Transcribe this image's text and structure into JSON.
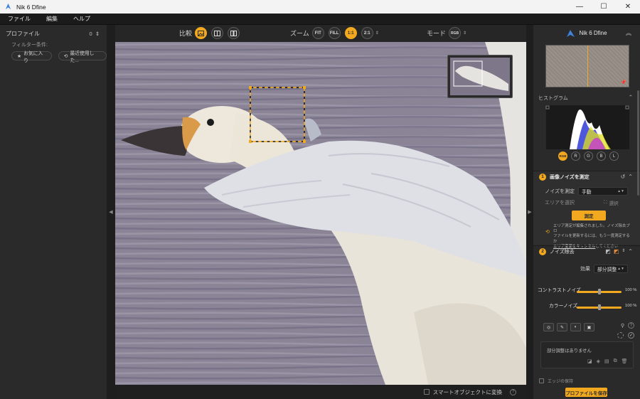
{
  "window": {
    "title": "Nik 6 Dfine",
    "controls": {
      "minimize": "—",
      "maximize": "☐",
      "close": "✕"
    }
  },
  "menu": [
    "ファイル",
    "編集",
    "ヘルプ"
  ],
  "left_panel": {
    "title": "プロファイル",
    "count": "0",
    "filter_label": "フィルター条件:",
    "chips": [
      {
        "icon": "star-icon",
        "label": "お気に入り"
      },
      {
        "icon": "recent-icon",
        "label": "最近使用した..."
      }
    ]
  },
  "toolbar": {
    "compare_label": "比較",
    "zoom_label": "ズーム",
    "zoom_options": [
      "FIT",
      "FILL",
      "1:1",
      "2:1"
    ],
    "zoom_selected": "1:1",
    "mode_label": "モード",
    "mode_value": "RGB"
  },
  "status": {
    "smart_object_label": "スマートオブジェクトに変換",
    "smart_object_checked": false,
    "help_icon": "?"
  },
  "right_panel": {
    "title": "Nik 6 Dfine",
    "histogram_title": "ヒストグラム",
    "channels": [
      "RGB",
      "R",
      "G",
      "B",
      "L"
    ],
    "channel_selected": "RGB",
    "measure": {
      "number": "1",
      "title": "画像ノイズを測定",
      "method_label": "ノイズを測定",
      "method_value": "手動",
      "area_label": "エリアを選択",
      "select_button": "選択",
      "measure_button": "測定",
      "note_line1": "エリア測定が編集されました。ノイズ除去プロ",
      "note_line2": "ファイルを更新するには、もう一度測定するか",
      "note_link": "エリア変更をキャンセル",
      "note_line3": "してください"
    },
    "reduce": {
      "number": "2",
      "title": "ノイズ除去",
      "effect_label": "効果",
      "effect_value": "部分調整",
      "contrast_label": "コントラストノイズ",
      "contrast_value": "100 %",
      "contrast_level": 1.0,
      "color_label": "カラーノイズ",
      "color_value": "100 %",
      "color_level": 1.0,
      "adjust_empty": "部分調整はありません"
    },
    "partial_section": "エッジの保持",
    "save_button": "プロファイルを保存"
  },
  "colors": {
    "accent": "#f2a91f",
    "panel": "#2a2a2a"
  }
}
